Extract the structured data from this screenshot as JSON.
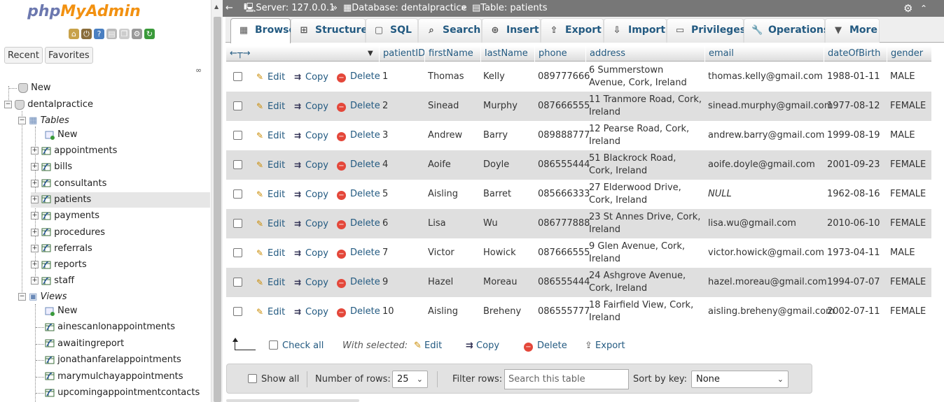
{
  "app": {
    "logo_php": "php",
    "logo_myadmin": "MyAdmin",
    "nav_tabs": [
      "Recent",
      "Favorites"
    ]
  },
  "tree": {
    "new_label": "New",
    "db_name": "dentalpractice",
    "tables_label": "Tables",
    "tables_new": "New",
    "tables": [
      "appointments",
      "bills",
      "consultants",
      "patients",
      "payments",
      "procedures",
      "referrals",
      "reports",
      "staff"
    ],
    "selected_table": "patients",
    "views_label": "Views",
    "views_new": "New",
    "views": [
      "ainescanlonappointments",
      "awaitingreport",
      "jonathanfarelappointments",
      "marymulchayappointments",
      "upcomingappointmentcontacts"
    ]
  },
  "breadcrumb": {
    "server": "Server: 127.0.0.1",
    "database": "Database: dentalpractice",
    "table": "Table: patients"
  },
  "tabs": [
    "Browse",
    "Structure",
    "SQL",
    "Search",
    "Insert",
    "Export",
    "Import",
    "Privileges",
    "Operations",
    "More"
  ],
  "active_tab": "Browse",
  "table": {
    "columns": [
      "patientID",
      "firstName",
      "lastName",
      "phone",
      "address",
      "email",
      "dateOfBirth",
      "gender"
    ],
    "actions": {
      "edit": "Edit",
      "copy": "Copy",
      "delete": "Delete"
    },
    "rows": [
      {
        "patientID": "1",
        "firstName": "Thomas",
        "lastName": "Kelly",
        "phone": "089777666",
        "address": "6 Summerstown Avenue, Cork, Ireland",
        "email": "thomas.kelly@gmail.com",
        "dateOfBirth": "1988-01-11",
        "gender": "MALE"
      },
      {
        "patientID": "2",
        "firstName": "Sinead",
        "lastName": "Murphy",
        "phone": "087666555",
        "address": "11 Tranmore Road, Cork, Ireland",
        "email": "sinead.murphy@gmail.com",
        "dateOfBirth": "1977-08-12",
        "gender": "FEMALE"
      },
      {
        "patientID": "3",
        "firstName": "Andrew",
        "lastName": "Barry",
        "phone": "089888777",
        "address": "12 Pearse Road, Cork, Ireland",
        "email": "andrew.barry@gmail.com",
        "dateOfBirth": "1999-08-19",
        "gender": "MALE"
      },
      {
        "patientID": "4",
        "firstName": "Aoife",
        "lastName": "Doyle",
        "phone": "086555444",
        "address": "51 Blackrock Road, Cork, Ireland",
        "email": "aoife.doyle@gmail.com",
        "dateOfBirth": "2001-09-23",
        "gender": "FEMALE"
      },
      {
        "patientID": "5",
        "firstName": "Aisling",
        "lastName": "Barret",
        "phone": "085666333",
        "address": "27 Elderwood Drive, Cork, Ireland",
        "email": "NULL",
        "dateOfBirth": "1962-08-16",
        "gender": "FEMALE"
      },
      {
        "patientID": "6",
        "firstName": "Lisa",
        "lastName": "Wu",
        "phone": "086777888",
        "address": "23 St Annes Drive, Cork, Ireland",
        "email": "lisa.wu@gmail.com",
        "dateOfBirth": "2010-06-10",
        "gender": "FEMALE"
      },
      {
        "patientID": "7",
        "firstName": "Victor",
        "lastName": "Howick",
        "phone": "087666555",
        "address": "9 Glen Avenue, Cork, Ireland",
        "email": "victor.howick@gmail.com",
        "dateOfBirth": "1973-04-11",
        "gender": "MALE"
      },
      {
        "patientID": "9",
        "firstName": "Hazel",
        "lastName": "Moreau",
        "phone": "086555444",
        "address": "24 Ashgrove Avenue, Cork, Ireland",
        "email": "hazel.moreau@gmail.com",
        "dateOfBirth": "1994-07-07",
        "gender": "FEMALE"
      },
      {
        "patientID": "10",
        "firstName": "Aisling",
        "lastName": "Breheny",
        "phone": "086555777",
        "address": "18 Fairfield View, Cork, Ireland",
        "email": "aisling.breheny@gmail.com",
        "dateOfBirth": "2002-07-11",
        "gender": "FEMALE"
      }
    ]
  },
  "bulk": {
    "check_all": "Check all",
    "with_selected": "With selected:",
    "edit": "Edit",
    "copy": "Copy",
    "delete": "Delete",
    "export": "Export"
  },
  "navbar": {
    "show_all": "Show all",
    "rows_label": "Number of rows:",
    "rows_value": "25",
    "filter_label": "Filter rows:",
    "filter_placeholder": "Search this table",
    "sort_label": "Sort by key:",
    "sort_value": "None"
  },
  "colors": {
    "link": "#235a81",
    "topbar": "#777777",
    "row_alt": "#dfdfdf",
    "delete": "#e4473a"
  }
}
